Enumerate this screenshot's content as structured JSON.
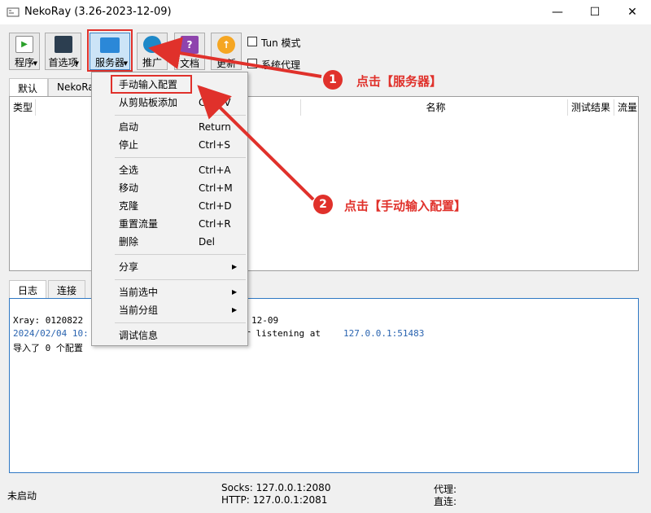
{
  "window": {
    "title": "NekoRay (3.26-2023-12-09)",
    "minimize": "—",
    "maximize": "☐",
    "close": "✕"
  },
  "toolbar": {
    "program": "程序",
    "preferences": "首选项",
    "server": "服务器",
    "promote": "推广",
    "docs": "文档",
    "update": "更新",
    "tun_mode": "Tun 模式",
    "system_proxy": "系统代理"
  },
  "group_tabs": [
    "默认",
    "NekoRa"
  ],
  "table_headers": {
    "type": "类型",
    "name": "名称",
    "test_result": "测试结果",
    "traffic": "流量"
  },
  "bottom_tabs": {
    "log": "日志",
    "connections": "连接"
  },
  "log_lines": [
    {
      "a": "Xray: 0120822",
      "b": "12-09"
    },
    {
      "a": "2024/02/04 10:",
      "b": "ver listening at ",
      "c": "127.0.0.1:51483"
    },
    {
      "a": "导入了 0 个配置"
    }
  ],
  "status": {
    "state": "未启动",
    "socks": "Socks: 127.0.0.1:2080",
    "http": "HTTP: 127.0.0.1:2081",
    "proxy": "代理:",
    "direct": "直连:"
  },
  "menu": {
    "items": [
      {
        "label": "手动输入配置",
        "shortcut": ""
      },
      {
        "label": "从剪贴板添加",
        "shortcut": "Ctrl+V"
      },
      {
        "label": "启动",
        "shortcut": "Return"
      },
      {
        "label": "停止",
        "shortcut": "Ctrl+S"
      },
      {
        "label": "全选",
        "shortcut": "Ctrl+A"
      },
      {
        "label": "移动",
        "shortcut": "Ctrl+M"
      },
      {
        "label": "克隆",
        "shortcut": "Ctrl+D"
      },
      {
        "label": "重置流量",
        "shortcut": "Ctrl+R"
      },
      {
        "label": "删除",
        "shortcut": "Del"
      },
      {
        "label": "分享",
        "shortcut": ""
      },
      {
        "label": "当前选中",
        "shortcut": ""
      },
      {
        "label": "当前分组",
        "shortcut": ""
      },
      {
        "label": "调试信息",
        "shortcut": ""
      }
    ]
  },
  "annotations": [
    {
      "num": "1",
      "text": "点击【服务器】"
    },
    {
      "num": "2",
      "text": "点击【手动输入配置】"
    }
  ],
  "colors": {
    "highlight": "#e0312b",
    "log_blue": "#2a64b0"
  }
}
